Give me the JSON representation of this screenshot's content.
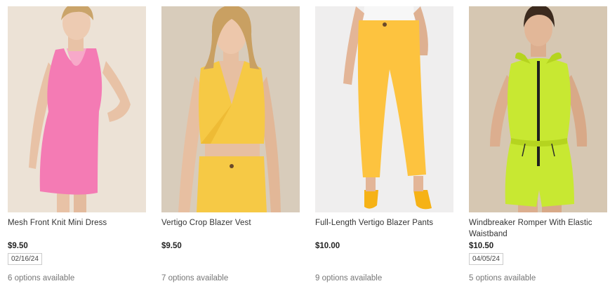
{
  "products": [
    {
      "title": "Mesh Front Knit Mini Dress",
      "price": "$9.50",
      "date": "02/16/24",
      "options": "6 options available",
      "image": "pink-dress-model",
      "bg_color": "#e9ddd0",
      "garment_color": "#f47bb4"
    },
    {
      "title": "Vertigo Crop Blazer Vest",
      "price": "$9.50",
      "options": "7 options available",
      "image": "yellow-crop-vest-model",
      "bg_color": "#d8ccbb",
      "garment_color": "#f6c945"
    },
    {
      "title": "Full-Length Vertigo Blazer Pants",
      "price": "$10.00",
      "options": "9 options available",
      "image": "yellow-pants-model",
      "bg_color": "#efeeee",
      "garment_color": "#fdc33f"
    },
    {
      "title": "Windbreaker Romper With Elastic Waistband",
      "price": "$10.50",
      "date": "04/05/24",
      "options": "5 options available",
      "image": "lime-romper-model",
      "bg_color": "#d6c7b2",
      "garment_color": "#c8e832"
    }
  ]
}
